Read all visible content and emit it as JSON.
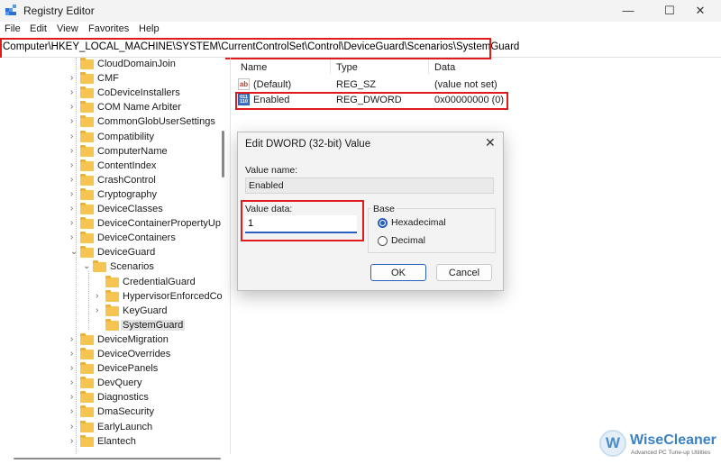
{
  "window": {
    "title": "Registry Editor",
    "minimize": "—",
    "maximize": "☐",
    "close": "✕"
  },
  "menu": [
    "File",
    "Edit",
    "View",
    "Favorites",
    "Help"
  ],
  "address": "Computer\\HKEY_LOCAL_MACHINE\\SYSTEM\\CurrentControlSet\\Control\\DeviceGuard\\Scenarios\\SystemGuard",
  "tree": [
    {
      "label": "CloudDomainJoin",
      "chevron": "",
      "level": 0
    },
    {
      "label": "CMF",
      "chevron": ">",
      "level": 0
    },
    {
      "label": "CoDeviceInstallers",
      "chevron": ">",
      "level": 0
    },
    {
      "label": "COM Name Arbiter",
      "chevron": ">",
      "level": 0
    },
    {
      "label": "CommonGlobUserSettings",
      "chevron": ">",
      "level": 0
    },
    {
      "label": "Compatibility",
      "chevron": ">",
      "level": 0
    },
    {
      "label": "ComputerName",
      "chevron": ">",
      "level": 0
    },
    {
      "label": "ContentIndex",
      "chevron": ">",
      "level": 0
    },
    {
      "label": "CrashControl",
      "chevron": ">",
      "level": 0
    },
    {
      "label": "Cryptography",
      "chevron": ">",
      "level": 0
    },
    {
      "label": "DeviceClasses",
      "chevron": ">",
      "level": 0
    },
    {
      "label": "DeviceContainerPropertyUp",
      "chevron": ">",
      "level": 0
    },
    {
      "label": "DeviceContainers",
      "chevron": ">",
      "level": 0
    },
    {
      "label": "DeviceGuard",
      "chevron": "v",
      "level": 0
    },
    {
      "label": "Scenarios",
      "chevron": "v",
      "level": 1
    },
    {
      "label": "CredentialGuard",
      "chevron": "",
      "level": 2
    },
    {
      "label": "HypervisorEnforcedCo",
      "chevron": ">",
      "level": 2
    },
    {
      "label": "KeyGuard",
      "chevron": ">",
      "level": 2
    },
    {
      "label": "SystemGuard",
      "chevron": "",
      "level": 2,
      "selected": true
    },
    {
      "label": "DeviceMigration",
      "chevron": ">",
      "level": 0
    },
    {
      "label": "DeviceOverrides",
      "chevron": ">",
      "level": 0
    },
    {
      "label": "DevicePanels",
      "chevron": ">",
      "level": 0
    },
    {
      "label": "DevQuery",
      "chevron": ">",
      "level": 0
    },
    {
      "label": "Diagnostics",
      "chevron": ">",
      "level": 0
    },
    {
      "label": "DmaSecurity",
      "chevron": ">",
      "level": 0
    },
    {
      "label": "EarlyLaunch",
      "chevron": ">",
      "level": 0
    },
    {
      "label": "Elantech",
      "chevron": ">",
      "level": 0
    }
  ],
  "columns": {
    "name": "Name",
    "type": "Type",
    "data": "Data"
  },
  "values": [
    {
      "icon": "string-value-icon",
      "name": "(Default)",
      "type": "REG_SZ",
      "data": "(value not set)"
    },
    {
      "icon": "dword-value-icon",
      "name": "Enabled",
      "type": "REG_DWORD",
      "data": "0x00000000 (0)"
    }
  ],
  "dialog": {
    "title": "Edit DWORD (32-bit) Value",
    "close": "✕",
    "value_name_label": "Value name:",
    "value_name": "Enabled",
    "value_data_label": "Value data:",
    "value_data": "1",
    "base_label": "Base",
    "hex_label": "Hexadecimal",
    "dec_label": "Decimal",
    "selected_base": "Hexadecimal",
    "ok": "OK",
    "cancel": "Cancel"
  },
  "watermark": {
    "logo_letter": "W",
    "brand": "WiseCleaner",
    "tagline": "Advanced PC Tune-up Utilities"
  },
  "colors": {
    "highlight_box": "#e01b1b",
    "accent": "#2a5fbf",
    "folder": "#f5c451"
  }
}
